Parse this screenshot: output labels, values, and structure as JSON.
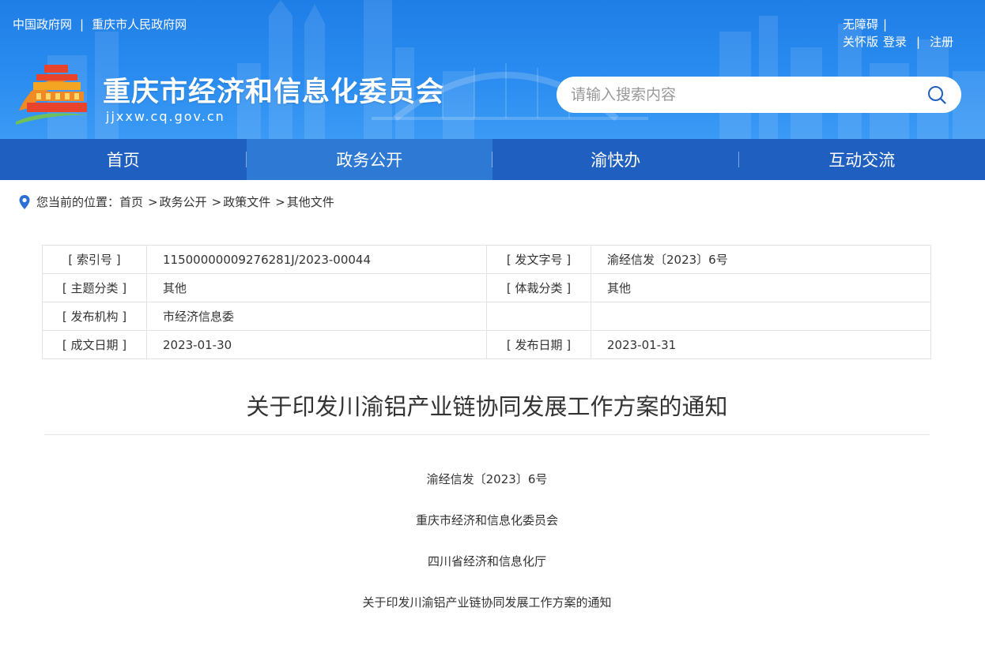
{
  "header": {
    "top_links": [
      "中国政府网",
      "重庆市人民政府网"
    ],
    "top_sep": "|",
    "right_links": {
      "accessibility": "无障碍",
      "care": "关怀版",
      "login": "登录",
      "register": "注册",
      "sep": "|"
    },
    "site_title": "重庆市经济和信息化委员会",
    "site_domain": "jjxxw.cq.gov.cn",
    "search_placeholder": "请输入搜索内容",
    "colors": {
      "header_blue": "#2a8cf0",
      "nav_blue": "#1f5fbf",
      "nav_active": "#2d79d4"
    }
  },
  "nav": {
    "items": [
      {
        "label": "首页"
      },
      {
        "label": "政务公开"
      },
      {
        "label": "渝快办"
      },
      {
        "label": "互动交流"
      }
    ],
    "active_index": 1
  },
  "breadcrumb": {
    "prefix": "您当前的位置：",
    "items": [
      "首页",
      "政务公开",
      "政策文件",
      "其他文件"
    ],
    "sep": ">"
  },
  "info_table": {
    "rows": [
      {
        "k1": "[ 索引号 ]",
        "v1": "11500000009276281J/2023-00044",
        "k2": "[ 发文字号 ]",
        "v2": "渝经信发〔2023〕6号"
      },
      {
        "k1": "[ 主题分类 ]",
        "v1": "其他",
        "k2": "[ 体裁分类 ]",
        "v2": "其他"
      },
      {
        "k1": "[ 发布机构 ]",
        "v1": "市经济信息委",
        "k2": "",
        "v2": ""
      },
      {
        "k1": "[ 成文日期 ]",
        "v1": "2023-01-30",
        "k2": "[ 发布日期 ]",
        "v2": "2023-01-31"
      }
    ]
  },
  "article": {
    "title": "关于印发川渝铝产业链协同发展工作方案的通知",
    "paragraphs": [
      "渝经信发〔2023〕6号",
      "重庆市经济和信息化委员会",
      "四川省经济和信息化厅",
      "关于印发川渝铝产业链协同发展工作方案的通知"
    ]
  }
}
